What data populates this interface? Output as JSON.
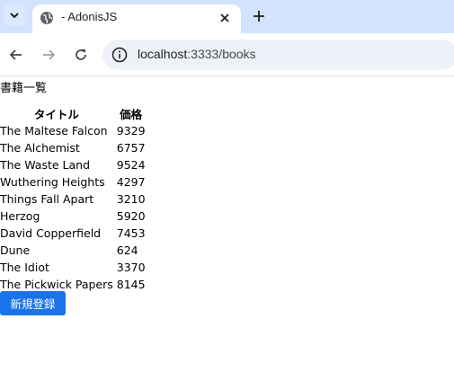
{
  "browser": {
    "tab_title": "- AdonisJS",
    "url_host": "localhost",
    "url_path": ":3333/books"
  },
  "page": {
    "heading": "書籍一覧",
    "columns": [
      "タイトル",
      "価格"
    ],
    "books": [
      {
        "title": "The Maltese Falcon",
        "price": "9329"
      },
      {
        "title": "The Alchemist",
        "price": "6757"
      },
      {
        "title": "The Waste Land",
        "price": "9524"
      },
      {
        "title": "Wuthering Heights",
        "price": "4297"
      },
      {
        "title": "Things Fall Apart",
        "price": "3210"
      },
      {
        "title": "Herzog",
        "price": "5920"
      },
      {
        "title": "David Copperfield",
        "price": "7453"
      },
      {
        "title": "Dune",
        "price": "624"
      },
      {
        "title": "The Idiot",
        "price": "3370"
      },
      {
        "title": "The Pickwick Papers",
        "price": "8145"
      }
    ],
    "register_button": "新規登録"
  },
  "colors": {
    "tabbar_bg": "#d3e3fd",
    "button_bg": "#1a73e8"
  },
  "icons": [
    "tab-search-icon",
    "globe-icon",
    "close-icon",
    "plus-icon",
    "back-arrow-icon",
    "forward-arrow-icon",
    "reload-icon",
    "site-info-icon"
  ]
}
